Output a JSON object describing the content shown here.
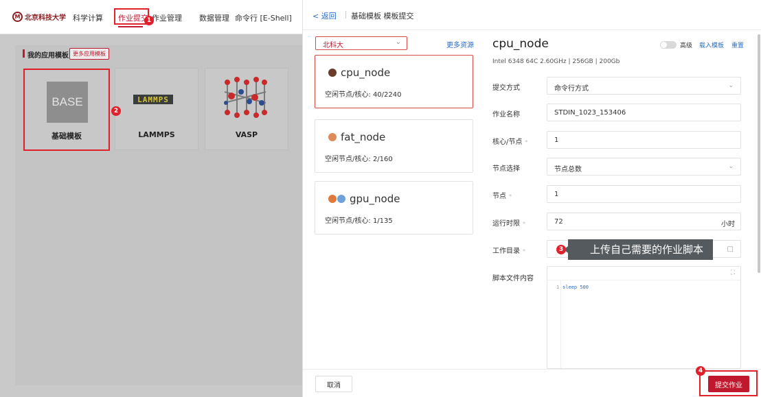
{
  "topnav": {
    "logo_text": "北京科技大学",
    "items": [
      "科学计算",
      "作业提交",
      "作业管理",
      "数据管理",
      "命令行 [E-Shell]"
    ],
    "active_index": 1
  },
  "left": {
    "section_title": "我的应用模板",
    "more_templates": "更多应用模板",
    "templates": [
      {
        "label": "基础模板",
        "image_text": "BASE"
      },
      {
        "label": "LAMMPS",
        "image_text": "LAMMPS"
      },
      {
        "label": "VASP"
      }
    ]
  },
  "annotations": {
    "step1": "1",
    "step2": "2",
    "step3": "3",
    "step4": "4"
  },
  "drawer": {
    "back": "< 返回",
    "breadcrumb": "基础模板 模板提交",
    "cluster_select": "北科大",
    "more_resources": "更多资源",
    "nodes": [
      {
        "name": "cpu_node",
        "stat_label": "空闲节点/核心:",
        "stat_value": "40/2240",
        "selected": true
      },
      {
        "name": "fat_node",
        "stat_label": "空闲节点/核心:",
        "stat_value": "2/160",
        "selected": false
      },
      {
        "name": "gpu_node",
        "stat_label": "空闲节点/核心:",
        "stat_value": "1/135",
        "selected": false
      }
    ],
    "node_title": "cpu_node",
    "node_spec": "Intel 6348 64C 2.60GHz | 256GB | 200Gb",
    "advanced": "高级",
    "load_template": "载入模板",
    "reset": "重置",
    "form": {
      "submit_mode_label": "提交方式",
      "submit_mode_value": "命令行方式",
      "job_name_label": "作业名称",
      "job_name_value": "STDIN_1023_153406",
      "cores_label": "核心/节点",
      "cores_value": "1",
      "node_select_label": "节点选择",
      "node_select_value": "节点总数",
      "nodes_label": "节点",
      "nodes_value": "1",
      "runtime_label": "运行时限",
      "runtime_value": "72",
      "runtime_unit": "小时",
      "workdir_label": "工作目录",
      "script_label": "脚本文件内容",
      "script_line_no": "1",
      "script_code": "sleep 500"
    },
    "tooltip": "上传自己需要的作业脚本",
    "cancel": "取消",
    "submit": "提交作业"
  },
  "colors": {
    "accent": "#c0192f",
    "link": "#2b6cc4",
    "annotation_red": "#e0202a"
  }
}
